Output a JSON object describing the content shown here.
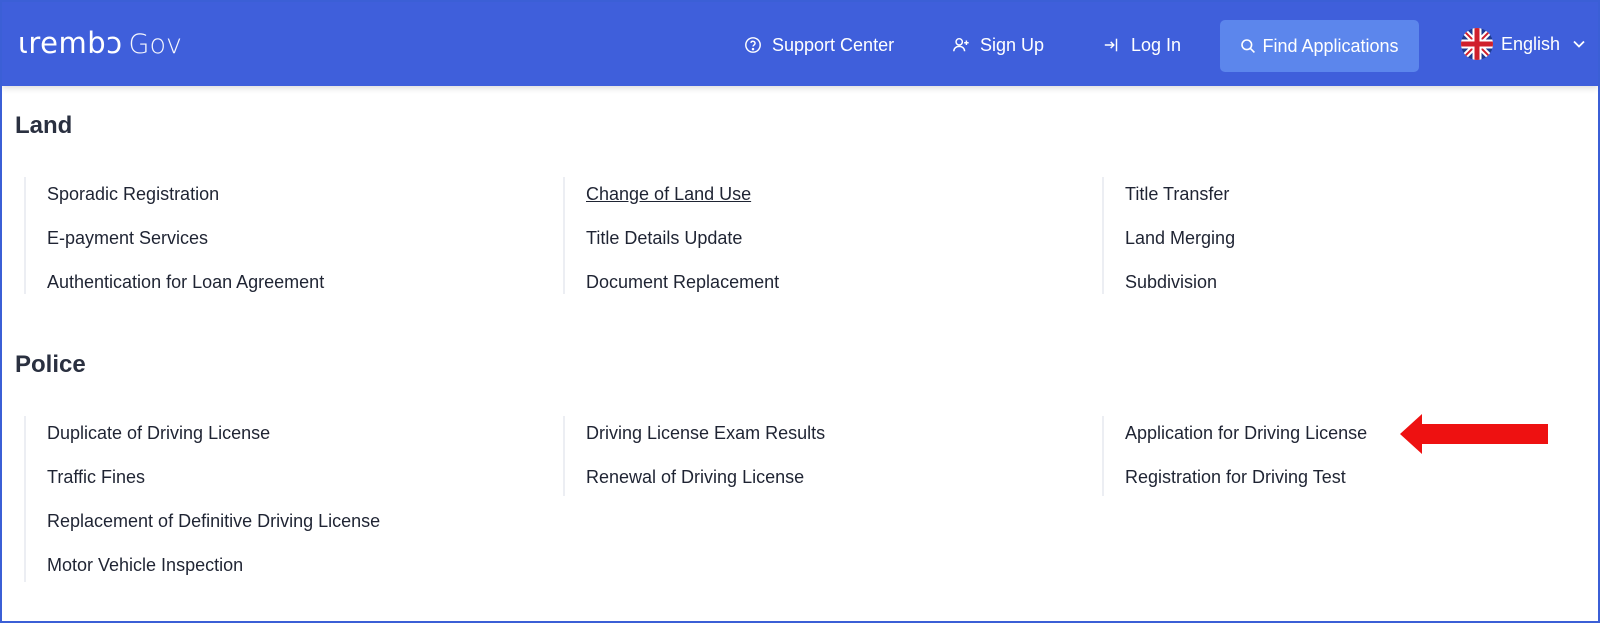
{
  "header": {
    "logo_brand": "ιrembɔ",
    "logo_gov": "Gov",
    "nav": {
      "support": "Support Center",
      "signup": "Sign Up",
      "login": "Log In",
      "find": "Find Applications",
      "language": "English"
    }
  },
  "sections": [
    {
      "title": "Land",
      "columns": [
        [
          "Sporadic Registration",
          "E-payment Services",
          "Authentication for Loan Agreement"
        ],
        [
          "Change of Land Use",
          "Title Details Update",
          "Document Replacement"
        ],
        [
          "Title Transfer",
          "Land Merging",
          "Subdivision"
        ]
      ]
    },
    {
      "title": "Police",
      "columns": [
        [
          "Duplicate of Driving License",
          "Traffic Fines",
          "Replacement of Definitive Driving License",
          "Motor Vehicle Inspection"
        ],
        [
          "Driving License Exam Results",
          "Renewal of Driving License"
        ],
        [
          "Application for Driving License",
          "Registration for Driving Test"
        ]
      ]
    }
  ],
  "colors": {
    "navbar": "#3f5fdb",
    "find_button": "#5c86ec",
    "annotation_arrow": "#ee1111"
  },
  "icons": [
    "help-circle-icon",
    "user-plus-icon",
    "login-icon",
    "search-icon",
    "uk-flag-icon",
    "chevron-down-icon",
    "red-arrow-annotation"
  ]
}
